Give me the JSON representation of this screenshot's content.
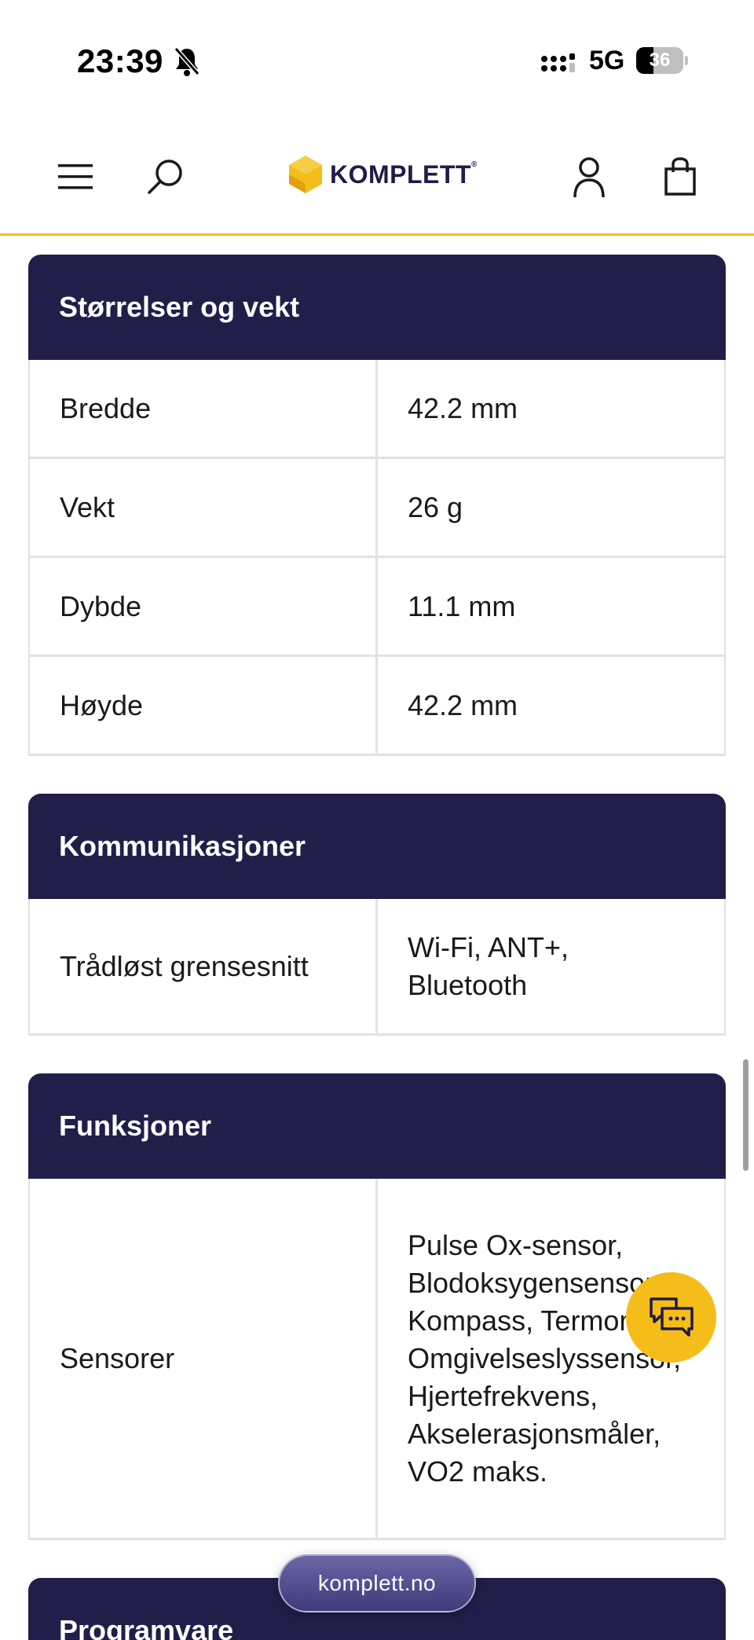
{
  "status_bar": {
    "time": "23:39",
    "network": "5G",
    "battery_level": "36"
  },
  "header": {
    "logo_text": "KOMPLETT",
    "logo_mark": "®",
    "brand_color": "#f5bd1a",
    "brand_dark": "#211e4a"
  },
  "sections": [
    {
      "title": "Størrelser og vekt",
      "rows": [
        {
          "key": "Bredde",
          "value": "42.2 mm"
        },
        {
          "key": "Vekt",
          "value": "26 g"
        },
        {
          "key": "Dybde",
          "value": "11.1 mm"
        },
        {
          "key": "Høyde",
          "value": "42.2 mm"
        }
      ]
    },
    {
      "title": "Kommunikasjoner",
      "rows": [
        {
          "key": "Trådløst grensesnitt",
          "value": "Wi-Fi, ANT+, Bluetooth"
        }
      ]
    },
    {
      "title": "Funksjoner",
      "rows": [
        {
          "key": "Sensorer",
          "value": "Pulse Ox-sensor, Blodoksygensensor, Kompass, Termometer, Omgivelseslyssensor, Hjertefrekvens, Akselerasjonsmåler, VO2 maks."
        }
      ]
    },
    {
      "title": "Programvare",
      "rows": []
    }
  ],
  "url_bar": {
    "domain": "komplett.no"
  }
}
